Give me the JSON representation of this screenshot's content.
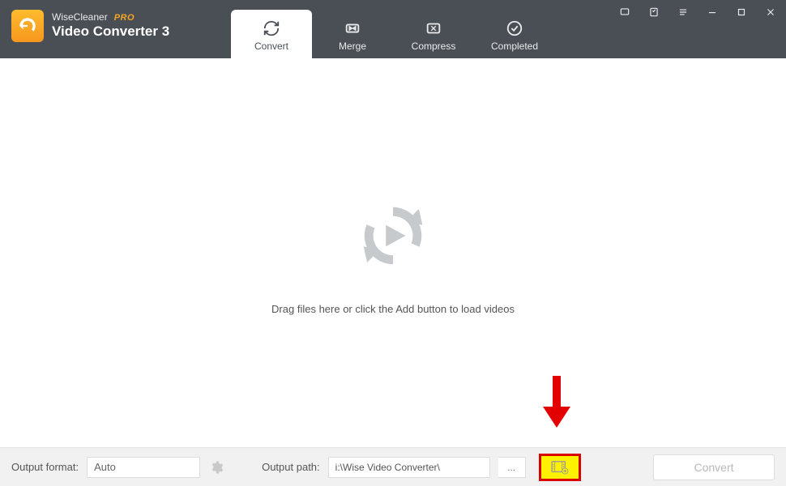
{
  "brand": {
    "company": "WiseCleaner",
    "pro": "PRO",
    "product": "Video Converter 3"
  },
  "tabs": {
    "convert": "Convert",
    "merge": "Merge",
    "compress": "Compress",
    "completed": "Completed"
  },
  "main": {
    "drop_text": "Drag files here or click the Add button to load videos"
  },
  "footer": {
    "format_label": "Output format:",
    "format_value": "Auto",
    "path_label": "Output path:",
    "path_value": "i:\\Wise Video Converter\\",
    "browse_label": "...",
    "convert_label": "Convert"
  }
}
